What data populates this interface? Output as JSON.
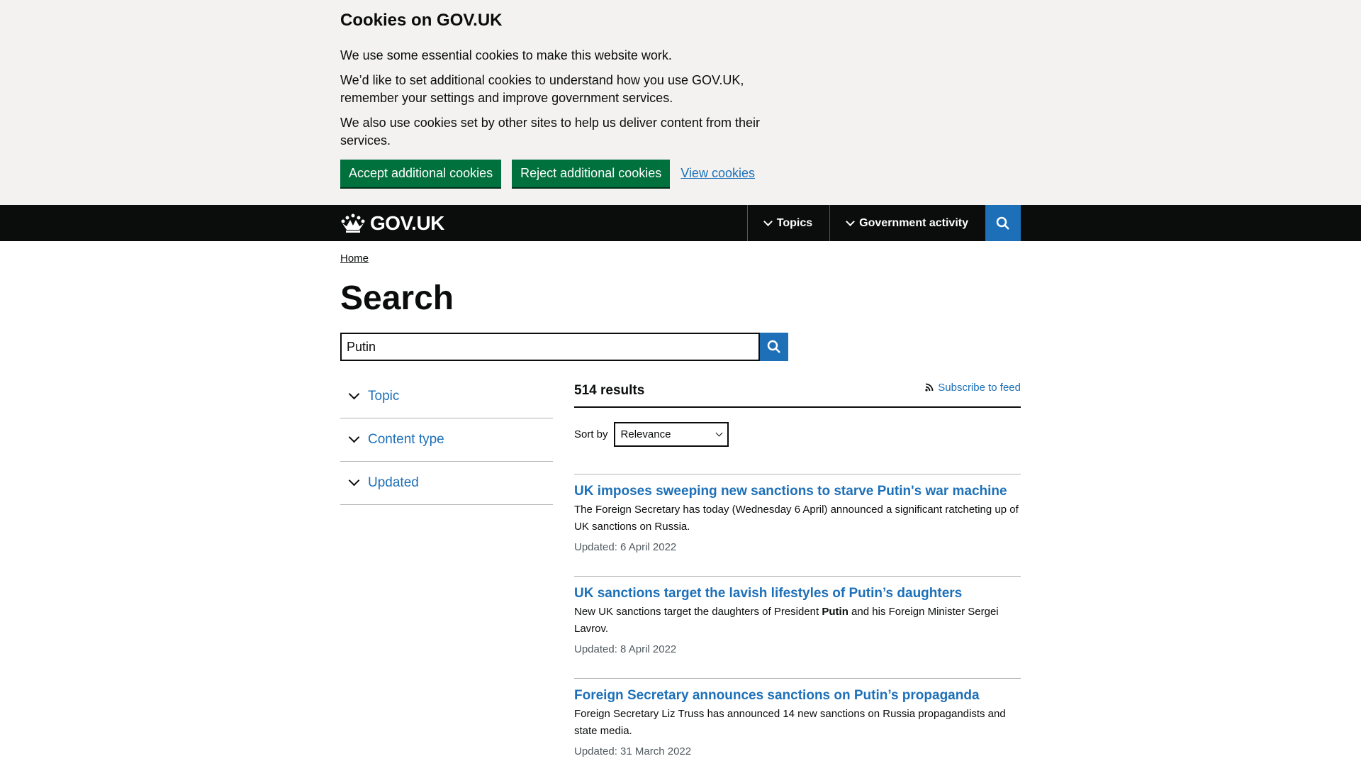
{
  "cookie_banner": {
    "title": "Cookies on GOV.UK",
    "p1": "We use some essential cookies to make this website work.",
    "p2": "We’d like to set additional cookies to understand how you use GOV.UK, remember your settings and improve government services.",
    "p3": "We also use cookies set by other sites to help us deliver content from their services.",
    "accept_label": "Accept additional cookies",
    "reject_label": "Reject additional cookies",
    "view_label": "View cookies"
  },
  "header": {
    "logo_text": "GOV.UK",
    "nav_topics": "Topics",
    "nav_activity": "Government activity"
  },
  "breadcrumb": {
    "home": "Home"
  },
  "page": {
    "title": "Search",
    "search_value": "Putin"
  },
  "filters": {
    "topic": "Topic",
    "content_type": "Content type",
    "updated": "Updated"
  },
  "results": {
    "count": "514 results",
    "subscribe": "Subscribe to feed",
    "sort_label": "Sort by",
    "sort_value": "Relevance",
    "items": [
      {
        "title": "UK imposes sweeping new sanctions to starve Putin's war machine",
        "desc": "The Foreign Secretary has today (Wednesday 6 April) announced a significant ratcheting up of UK sanctions on Russia.",
        "meta": "Updated: 6 April 2022"
      },
      {
        "title": "UK sanctions target the lavish lifestyles of Putin’s daughters",
        "desc_a": "New UK sanctions target the daughters of President ",
        "desc_b": "Putin",
        "desc_c": " and his Foreign Minister Sergei Lavrov.",
        "meta": "Updated: 8 April 2022"
      },
      {
        "title": "Foreign Secretary announces sanctions on Putin’s propaganda",
        "desc": "Foreign Secretary Liz Truss has announced 14 new sanctions on Russia propagandists and state media.",
        "meta": "Updated: 31 March 2022"
      }
    ]
  }
}
